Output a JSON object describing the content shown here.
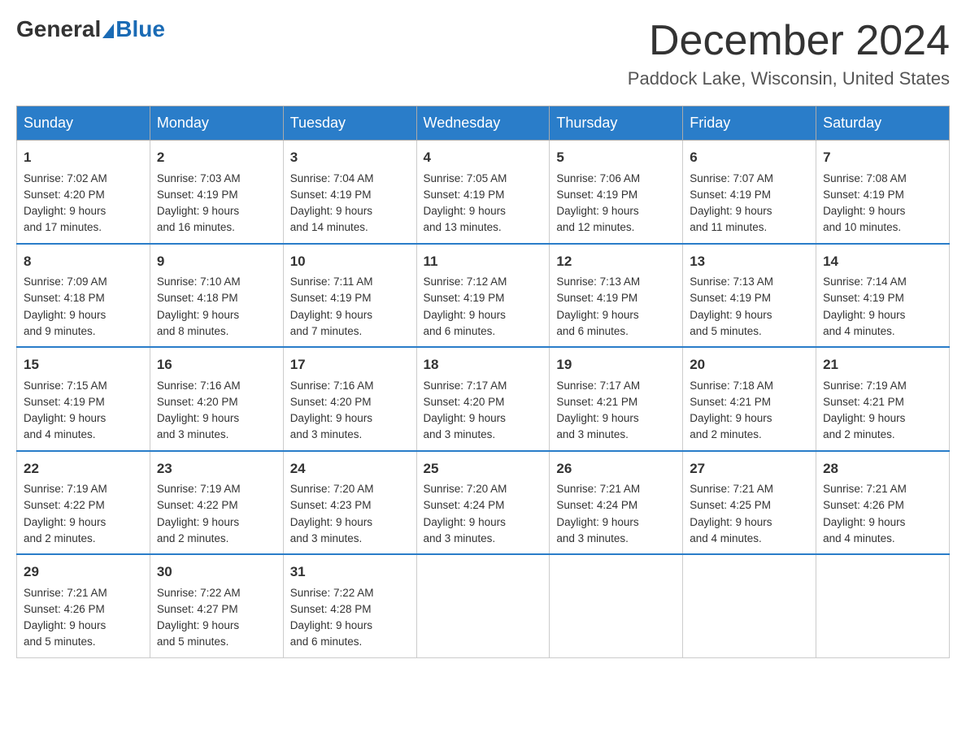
{
  "header": {
    "logo_general": "General",
    "logo_blue": "Blue",
    "month_title": "December 2024",
    "location": "Paddock Lake, Wisconsin, United States"
  },
  "days_of_week": [
    "Sunday",
    "Monday",
    "Tuesday",
    "Wednesday",
    "Thursday",
    "Friday",
    "Saturday"
  ],
  "weeks": [
    [
      {
        "date": "1",
        "sunrise": "7:02 AM",
        "sunset": "4:20 PM",
        "daylight": "9 hours and 17 minutes."
      },
      {
        "date": "2",
        "sunrise": "7:03 AM",
        "sunset": "4:19 PM",
        "daylight": "9 hours and 16 minutes."
      },
      {
        "date": "3",
        "sunrise": "7:04 AM",
        "sunset": "4:19 PM",
        "daylight": "9 hours and 14 minutes."
      },
      {
        "date": "4",
        "sunrise": "7:05 AM",
        "sunset": "4:19 PM",
        "daylight": "9 hours and 13 minutes."
      },
      {
        "date": "5",
        "sunrise": "7:06 AM",
        "sunset": "4:19 PM",
        "daylight": "9 hours and 12 minutes."
      },
      {
        "date": "6",
        "sunrise": "7:07 AM",
        "sunset": "4:19 PM",
        "daylight": "9 hours and 11 minutes."
      },
      {
        "date": "7",
        "sunrise": "7:08 AM",
        "sunset": "4:19 PM",
        "daylight": "9 hours and 10 minutes."
      }
    ],
    [
      {
        "date": "8",
        "sunrise": "7:09 AM",
        "sunset": "4:18 PM",
        "daylight": "9 hours and 9 minutes."
      },
      {
        "date": "9",
        "sunrise": "7:10 AM",
        "sunset": "4:18 PM",
        "daylight": "9 hours and 8 minutes."
      },
      {
        "date": "10",
        "sunrise": "7:11 AM",
        "sunset": "4:19 PM",
        "daylight": "9 hours and 7 minutes."
      },
      {
        "date": "11",
        "sunrise": "7:12 AM",
        "sunset": "4:19 PM",
        "daylight": "9 hours and 6 minutes."
      },
      {
        "date": "12",
        "sunrise": "7:13 AM",
        "sunset": "4:19 PM",
        "daylight": "9 hours and 6 minutes."
      },
      {
        "date": "13",
        "sunrise": "7:13 AM",
        "sunset": "4:19 PM",
        "daylight": "9 hours and 5 minutes."
      },
      {
        "date": "14",
        "sunrise": "7:14 AM",
        "sunset": "4:19 PM",
        "daylight": "9 hours and 4 minutes."
      }
    ],
    [
      {
        "date": "15",
        "sunrise": "7:15 AM",
        "sunset": "4:19 PM",
        "daylight": "9 hours and 4 minutes."
      },
      {
        "date": "16",
        "sunrise": "7:16 AM",
        "sunset": "4:20 PM",
        "daylight": "9 hours and 3 minutes."
      },
      {
        "date": "17",
        "sunrise": "7:16 AM",
        "sunset": "4:20 PM",
        "daylight": "9 hours and 3 minutes."
      },
      {
        "date": "18",
        "sunrise": "7:17 AM",
        "sunset": "4:20 PM",
        "daylight": "9 hours and 3 minutes."
      },
      {
        "date": "19",
        "sunrise": "7:17 AM",
        "sunset": "4:21 PM",
        "daylight": "9 hours and 3 minutes."
      },
      {
        "date": "20",
        "sunrise": "7:18 AM",
        "sunset": "4:21 PM",
        "daylight": "9 hours and 2 minutes."
      },
      {
        "date": "21",
        "sunrise": "7:19 AM",
        "sunset": "4:21 PM",
        "daylight": "9 hours and 2 minutes."
      }
    ],
    [
      {
        "date": "22",
        "sunrise": "7:19 AM",
        "sunset": "4:22 PM",
        "daylight": "9 hours and 2 minutes."
      },
      {
        "date": "23",
        "sunrise": "7:19 AM",
        "sunset": "4:22 PM",
        "daylight": "9 hours and 2 minutes."
      },
      {
        "date": "24",
        "sunrise": "7:20 AM",
        "sunset": "4:23 PM",
        "daylight": "9 hours and 3 minutes."
      },
      {
        "date": "25",
        "sunrise": "7:20 AM",
        "sunset": "4:24 PM",
        "daylight": "9 hours and 3 minutes."
      },
      {
        "date": "26",
        "sunrise": "7:21 AM",
        "sunset": "4:24 PM",
        "daylight": "9 hours and 3 minutes."
      },
      {
        "date": "27",
        "sunrise": "7:21 AM",
        "sunset": "4:25 PM",
        "daylight": "9 hours and 4 minutes."
      },
      {
        "date": "28",
        "sunrise": "7:21 AM",
        "sunset": "4:26 PM",
        "daylight": "9 hours and 4 minutes."
      }
    ],
    [
      {
        "date": "29",
        "sunrise": "7:21 AM",
        "sunset": "4:26 PM",
        "daylight": "9 hours and 5 minutes."
      },
      {
        "date": "30",
        "sunrise": "7:22 AM",
        "sunset": "4:27 PM",
        "daylight": "9 hours and 5 minutes."
      },
      {
        "date": "31",
        "sunrise": "7:22 AM",
        "sunset": "4:28 PM",
        "daylight": "9 hours and 6 minutes."
      },
      null,
      null,
      null,
      null
    ]
  ]
}
